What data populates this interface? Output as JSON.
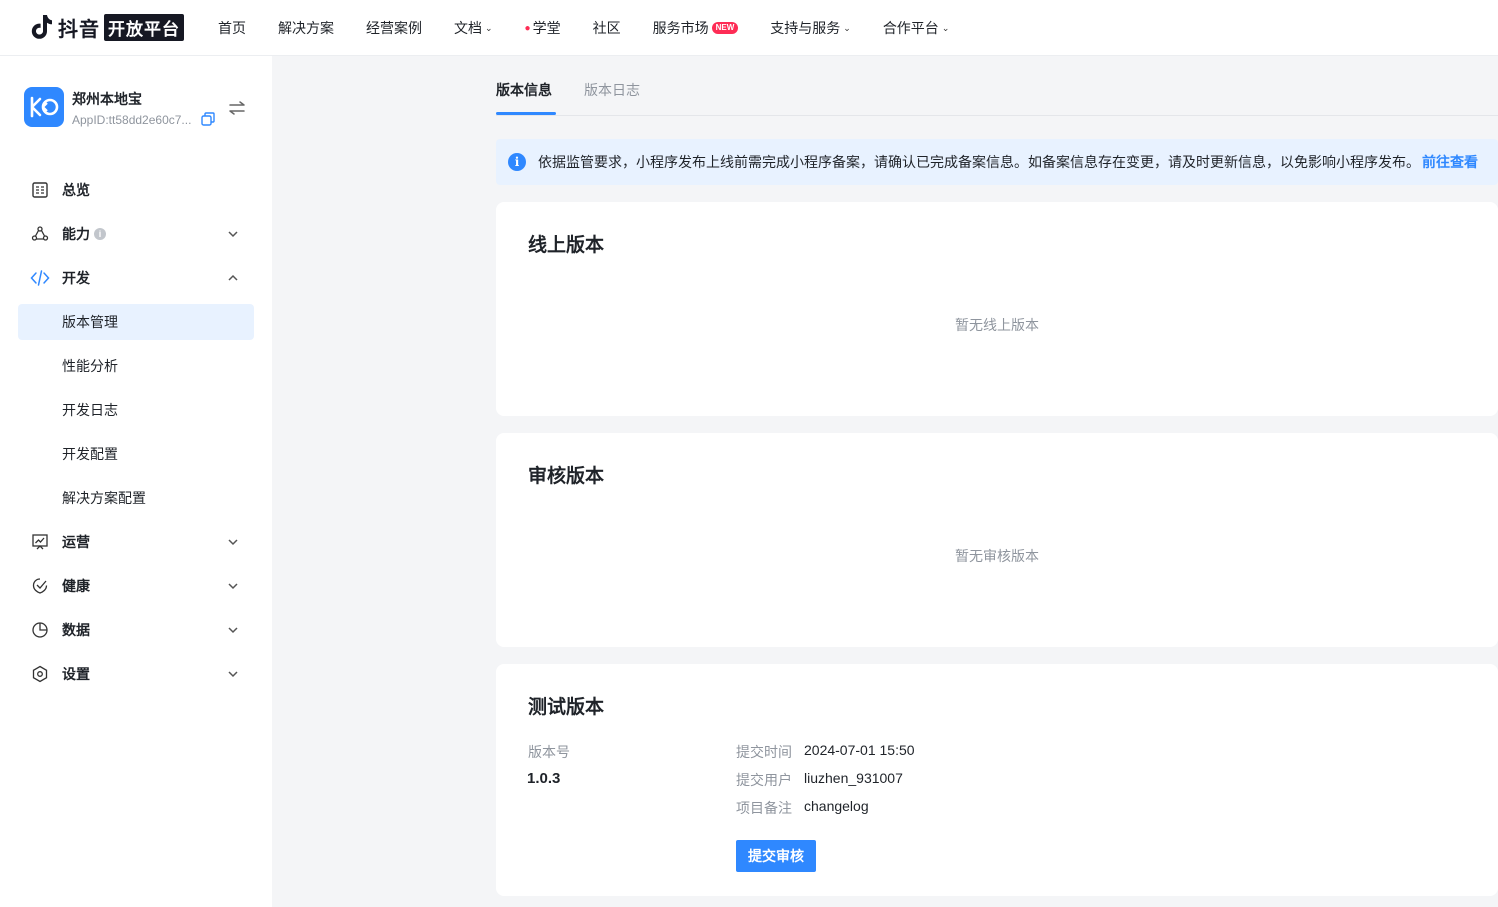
{
  "brand": {
    "name": "抖音",
    "badge": "开放平台"
  },
  "nav": {
    "items": [
      {
        "label": "首页",
        "caret": false
      },
      {
        "label": "解决方案",
        "caret": false
      },
      {
        "label": "经营案例",
        "caret": false
      },
      {
        "label": "文档",
        "caret": true
      },
      {
        "label": "学堂",
        "caret": false,
        "fire": true
      },
      {
        "label": "社区",
        "caret": false
      },
      {
        "label": "服务市场",
        "caret": false,
        "badge": "NEW"
      },
      {
        "label": "支持与服务",
        "caret": true
      },
      {
        "label": "合作平台",
        "caret": true
      }
    ]
  },
  "app": {
    "name": "郑州本地宝",
    "app_id": "AppID:tt58dd2e60c7..."
  },
  "sidebar": {
    "overview": "总览",
    "ability": "能力",
    "develop": "开发",
    "develop_sub": [
      "版本管理",
      "性能分析",
      "开发日志",
      "开发配置",
      "解决方案配置"
    ],
    "operate": "运营",
    "health": "健康",
    "data": "数据",
    "settings": "设置"
  },
  "tabs": {
    "active": "版本信息",
    "inactive": "版本日志"
  },
  "notice": {
    "text": "依据监管要求，小程序发布上线前需完成小程序备案，请确认已完成备案信息。如备案信息存在变更，请及时更新信息，以免影响小程序发布。",
    "link": "前往查看"
  },
  "online": {
    "title": "线上版本",
    "empty": "暂无线上版本"
  },
  "review": {
    "title": "审核版本",
    "empty": "暂无审核版本"
  },
  "test": {
    "title": "测试版本",
    "version_label": "版本号",
    "version": "1.0.3",
    "submit_time_label": "提交时间",
    "submit_time": "2024-07-01 15:50",
    "submit_user_label": "提交用户",
    "submit_user": "liuzhen_931007",
    "note_label": "项目备注",
    "note": "changelog",
    "button": "提交审核"
  },
  "colors": {
    "accent": "#2f88ff",
    "notice_bg": "#e8f2ff",
    "brand_red": "#fe2c55"
  }
}
